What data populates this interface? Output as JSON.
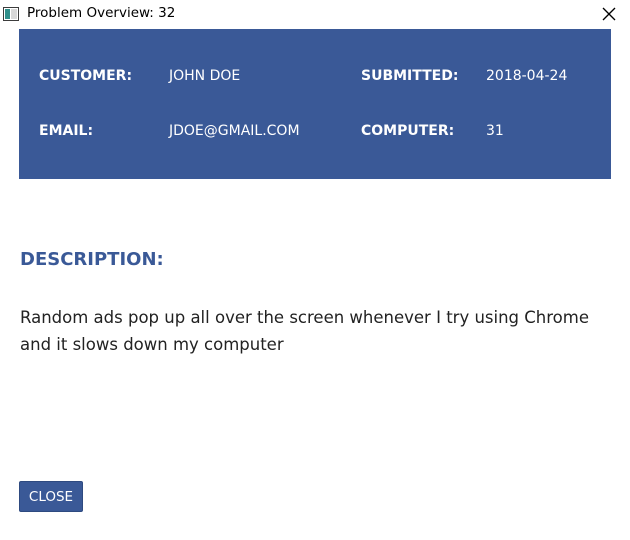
{
  "window": {
    "title": "Problem Overview: 32",
    "icons": {
      "app": "window-app-icon",
      "close": "close-icon"
    }
  },
  "customer_info": {
    "customer_label": "CUSTOMER:",
    "customer_value": "JOHN DOE",
    "submitted_label": "SUBMITTED:",
    "submitted_value": "2018-04-24",
    "email_label": "EMAIL:",
    "email_value": "JDOE@GMAIL.COM",
    "computer_label": "COMPUTER:",
    "computer_value": "31"
  },
  "description": {
    "heading": "DESCRIPTION:",
    "text": "Random ads pop up all over the screen whenever I try using Chrome and it slows down my computer"
  },
  "actions": {
    "close_label": "CLOSE"
  },
  "colors": {
    "accent": "#3a5997",
    "panel_text": "#ffffff",
    "body_text": "#222222"
  }
}
